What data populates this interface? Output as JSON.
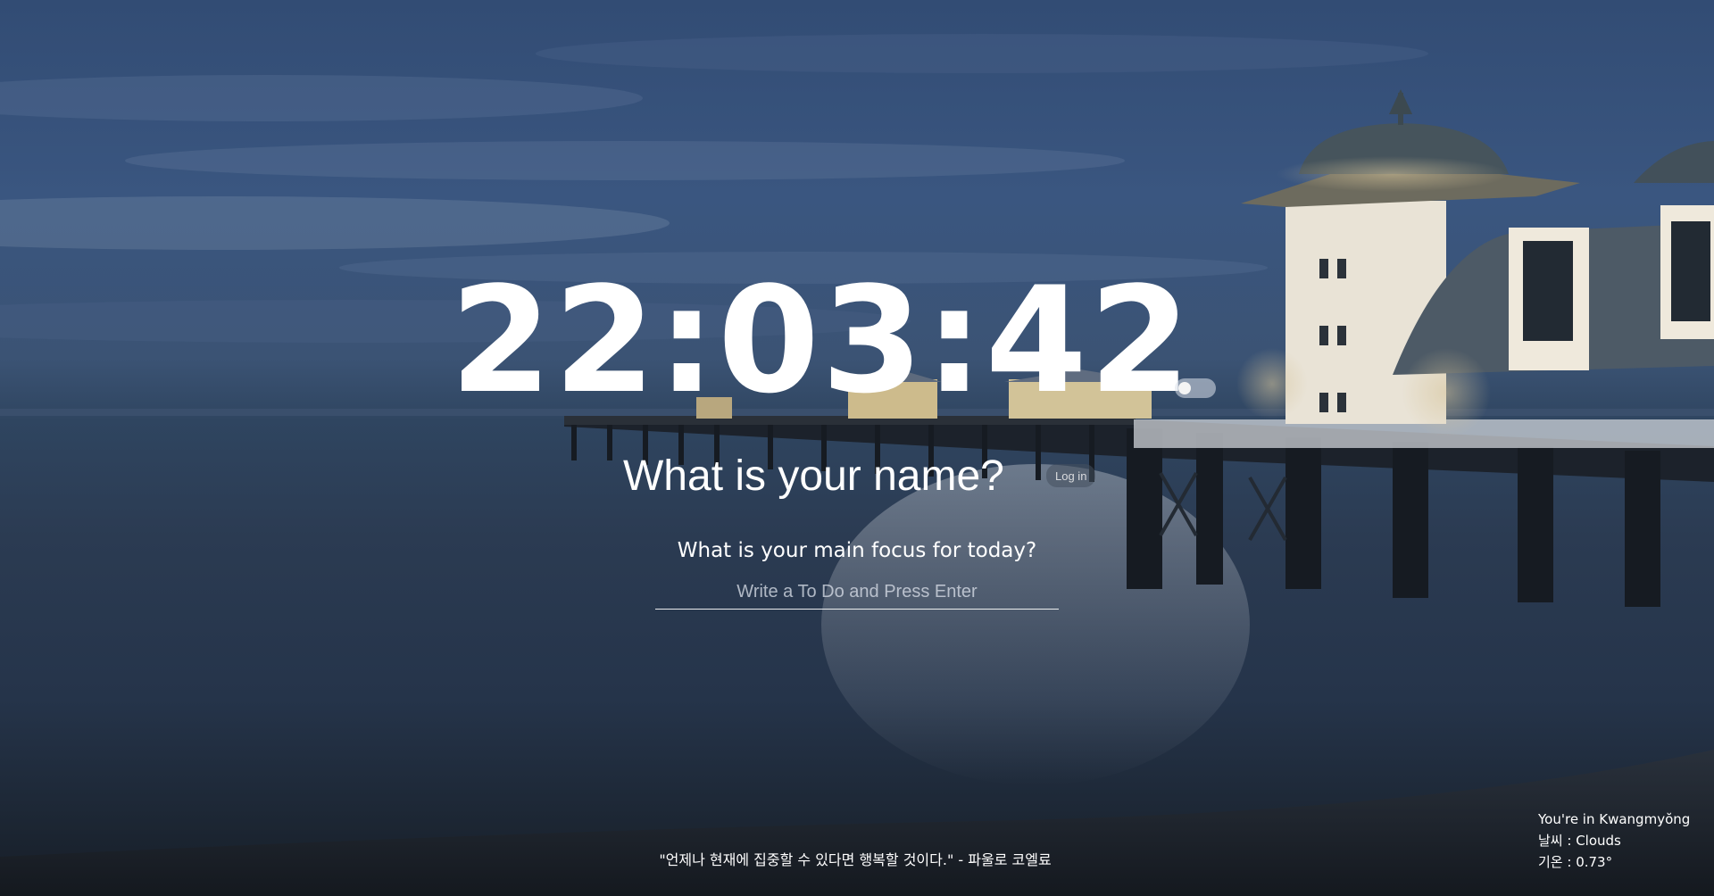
{
  "clock": {
    "time": "22:03:42"
  },
  "greeting": {
    "name_placeholder": "What is your name?",
    "login_label": "Log in"
  },
  "focus": {
    "title": "What is your main focus for today?",
    "todo_placeholder": "Write a To Do and Press Enter"
  },
  "quote": {
    "text": "\"언제나 현재에 집중할 수 있다면 행복할 것이다.\" - 파울로 코엘료"
  },
  "weather": {
    "location": "You're in Kwangmyŏng",
    "condition": "날씨 : Clouds",
    "temperature": "기온 : 0.73°"
  },
  "colors": {
    "text": "#ffffff",
    "sky": "#344f78",
    "sea": "#2b3b52"
  }
}
